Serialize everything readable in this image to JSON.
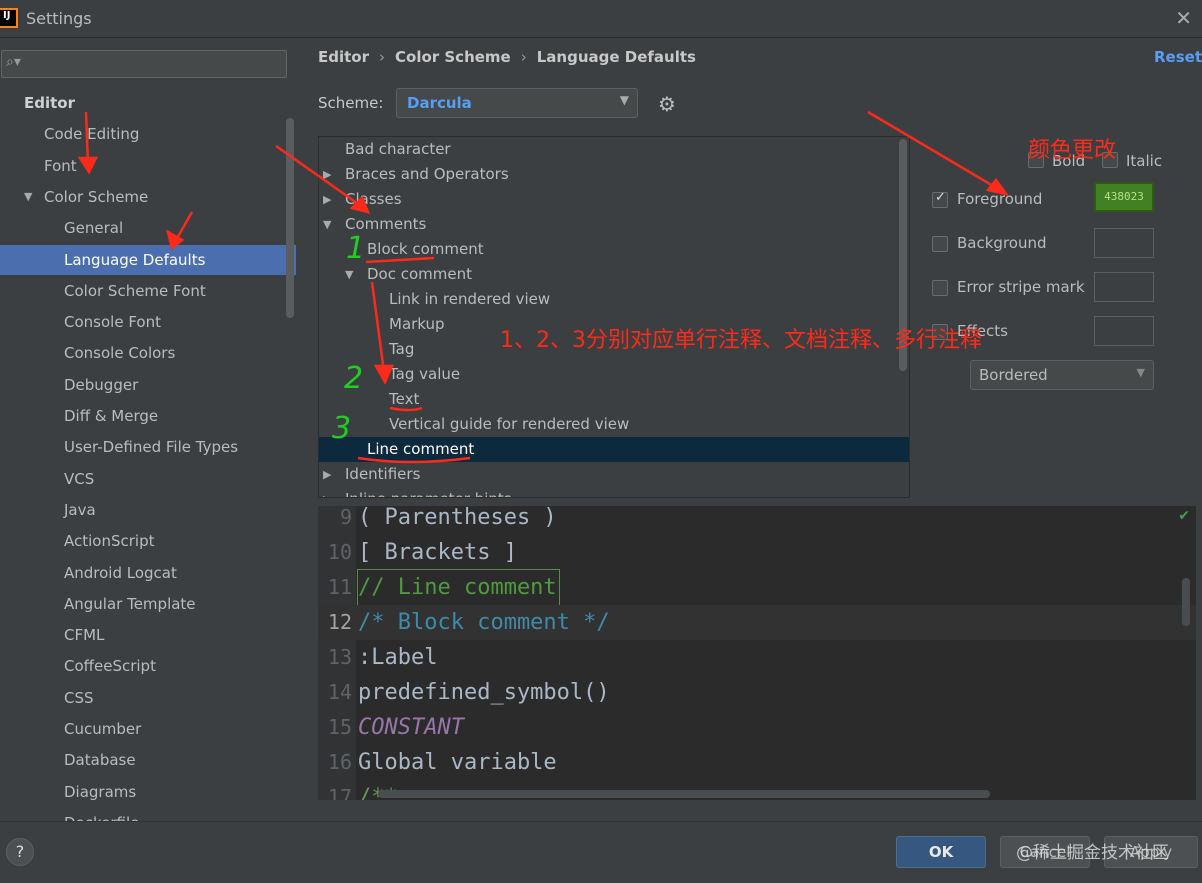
{
  "window": {
    "title": "Settings",
    "app_icon": "intellij-icon",
    "close_icon": "close-icon"
  },
  "sidebar": {
    "search_placeholder": "",
    "items": [
      {
        "label": "Editor",
        "level": 0,
        "expanded": null
      },
      {
        "label": "Code Editing",
        "level": 1
      },
      {
        "label": "Font",
        "level": 1
      },
      {
        "label": "Color Scheme",
        "level": 1,
        "expanded": true
      },
      {
        "label": "General",
        "level": 2
      },
      {
        "label": "Language Defaults",
        "level": 2,
        "selected": true
      },
      {
        "label": "Color Scheme Font",
        "level": 2
      },
      {
        "label": "Console Font",
        "level": 2
      },
      {
        "label": "Console Colors",
        "level": 2
      },
      {
        "label": "Debugger",
        "level": 2
      },
      {
        "label": "Diff & Merge",
        "level": 2
      },
      {
        "label": "User-Defined File Types",
        "level": 2
      },
      {
        "label": "VCS",
        "level": 2
      },
      {
        "label": "Java",
        "level": 2
      },
      {
        "label": "ActionScript",
        "level": 2
      },
      {
        "label": "Android Logcat",
        "level": 2
      },
      {
        "label": "Angular Template",
        "level": 2
      },
      {
        "label": "CFML",
        "level": 2
      },
      {
        "label": "CoffeeScript",
        "level": 2
      },
      {
        "label": "CSS",
        "level": 2
      },
      {
        "label": "Cucumber",
        "level": 2
      },
      {
        "label": "Database",
        "level": 2
      },
      {
        "label": "Diagrams",
        "level": 2
      },
      {
        "label": "Dockerfile",
        "level": 2
      }
    ]
  },
  "breadcrumb": [
    "Editor",
    "Color Scheme",
    "Language Defaults"
  ],
  "reset_label": "Reset",
  "scheme": {
    "label": "Scheme:",
    "value": "Darcula"
  },
  "attributes": [
    {
      "label": "Bad character",
      "indent": 0,
      "arrow": ""
    },
    {
      "label": "Braces and Operators",
      "indent": 0,
      "arrow": "right"
    },
    {
      "label": "Classes",
      "indent": 0,
      "arrow": "right"
    },
    {
      "label": "Comments",
      "indent": 0,
      "arrow": "down"
    },
    {
      "label": "Block comment",
      "indent": 1,
      "arrow": ""
    },
    {
      "label": "Doc comment",
      "indent": 1,
      "arrow": "down"
    },
    {
      "label": "Link in rendered view",
      "indent": 2,
      "arrow": ""
    },
    {
      "label": "Markup",
      "indent": 2,
      "arrow": ""
    },
    {
      "label": "Tag",
      "indent": 2,
      "arrow": ""
    },
    {
      "label": "Tag value",
      "indent": 2,
      "arrow": ""
    },
    {
      "label": "Text",
      "indent": 2,
      "arrow": ""
    },
    {
      "label": "Vertical guide for rendered view",
      "indent": 2,
      "arrow": ""
    },
    {
      "label": "Line comment",
      "indent": 1,
      "arrow": "",
      "selected": true
    },
    {
      "label": "Identifiers",
      "indent": 0,
      "arrow": "right"
    },
    {
      "label": "Inline parameter hints",
      "indent": 0,
      "arrow": "right"
    }
  ],
  "options": {
    "bold": {
      "label": "Bold",
      "checked": false
    },
    "italic": {
      "label": "Italic",
      "checked": false
    },
    "foreground": {
      "label": "Foreground",
      "checked": true,
      "color": "438023"
    },
    "background": {
      "label": "Background",
      "checked": false
    },
    "error_stripe": {
      "label": "Error stripe mark",
      "checked": false
    },
    "effects": {
      "label": "Effects",
      "checked": false
    },
    "effect_type": "Bordered"
  },
  "preview": [
    {
      "line": "9",
      "text": "( Parentheses )",
      "style": "normal"
    },
    {
      "line": "10",
      "text": "[ Brackets ]",
      "style": "normal"
    },
    {
      "line": "11",
      "text": "// Line comment",
      "style": "linecomment"
    },
    {
      "line": "12",
      "text": "/* Block comment */",
      "style": "blockcomment",
      "current": true
    },
    {
      "line": "13",
      "text": ":Label",
      "style": "normal"
    },
    {
      "line": "14",
      "text": "predefined_symbol()",
      "style": "normal"
    },
    {
      "line": "15",
      "text": "CONSTANT",
      "style": "const"
    },
    {
      "line": "16",
      "text": "Global variable",
      "style": "normal"
    },
    {
      "line": "17",
      "text": "/**",
      "style": "doc"
    }
  ],
  "footer": {
    "help": "?",
    "ok": "OK",
    "cancel": "Cancel",
    "apply": "Apply",
    "watermark": "@稀土掘金技术社区"
  },
  "annotations": {
    "color_change": "颜色更改",
    "mapping": "1、2、3分别对应单行注释、文档注释、多行注释",
    "num1": "1",
    "num2": "2",
    "num3": "3"
  },
  "colors": {
    "accent": "#4b6eaf",
    "link": "#589df6",
    "annotation": "#ff2a1a",
    "foreground_swatch": "#438023"
  }
}
